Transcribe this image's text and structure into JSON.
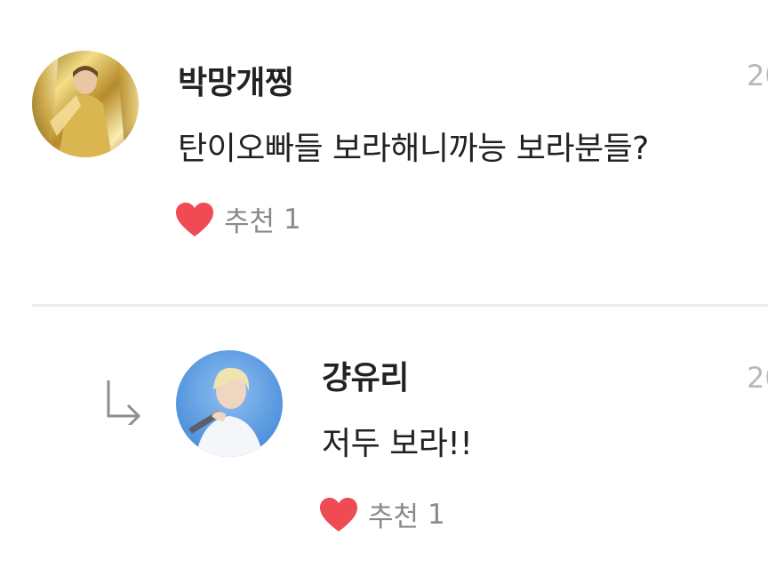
{
  "comments": [
    {
      "author": "박망개찡",
      "text": "탄이오빠들 보라해니까능 보라분들?",
      "date": "20",
      "like_label": "추천",
      "like_count": "1",
      "avatar_icon": "avatar-gold-costume-icon"
    },
    {
      "author": "걍유리",
      "text": "저두 보라!!",
      "date": "20",
      "like_label": "추천",
      "like_count": "1",
      "avatar_icon": "avatar-singer-blue-icon",
      "is_reply": true
    }
  ],
  "icons": {
    "like": "heart-icon",
    "reply": "reply-arrow-icon"
  },
  "colors": {
    "text": "#222222",
    "muted": "#8a8a8a",
    "date": "#b8b8b8",
    "heart": "#f04b55",
    "divider": "#ececec"
  }
}
